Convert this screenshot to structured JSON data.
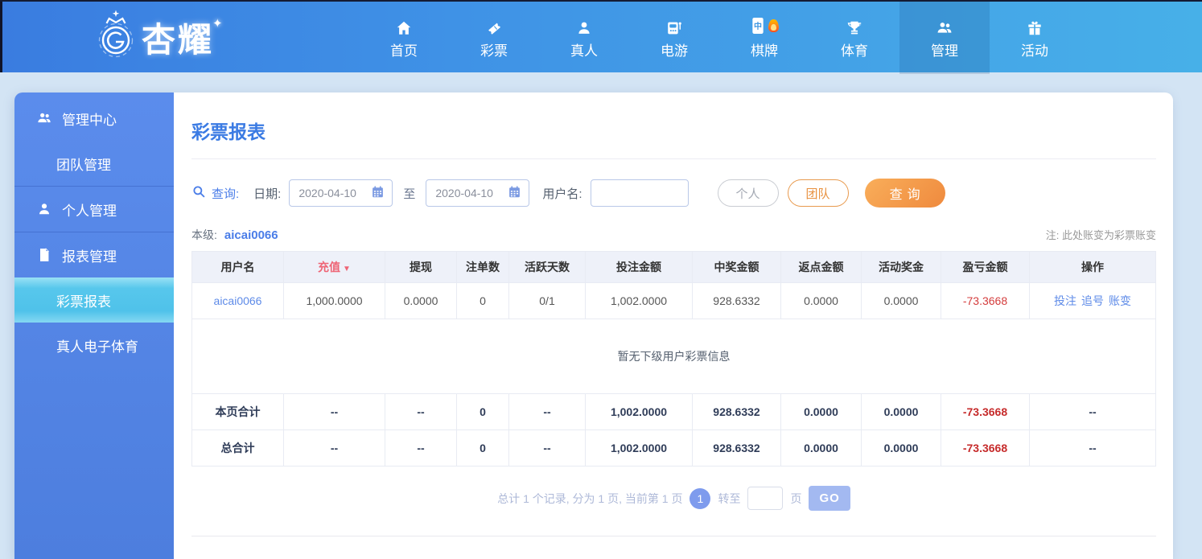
{
  "brand": {
    "name": "杏耀",
    "sparkle": "✦"
  },
  "nav": {
    "items": [
      {
        "label": "首页",
        "icon": "home-icon"
      },
      {
        "label": "彩票",
        "icon": "ticket-icon"
      },
      {
        "label": "真人",
        "icon": "person-icon"
      },
      {
        "label": "电游",
        "icon": "slot-machine-icon"
      },
      {
        "label": "棋牌",
        "icon": "mahjong-icon",
        "hot": true
      },
      {
        "label": "体育",
        "icon": "trophy-icon"
      },
      {
        "label": "管理",
        "icon": "team-icon",
        "active": true
      },
      {
        "label": "活动",
        "icon": "gift-icon"
      }
    ]
  },
  "sidebar": {
    "items": [
      {
        "label": "管理中心",
        "icon": "users-icon",
        "type": "section"
      },
      {
        "label": "团队管理",
        "type": "sub"
      },
      {
        "label": "个人管理",
        "icon": "user-icon",
        "type": "section"
      },
      {
        "label": "报表管理",
        "icon": "report-icon",
        "type": "section"
      },
      {
        "label": "彩票报表",
        "type": "sub",
        "active": true
      },
      {
        "label": "真人电子体育",
        "type": "sub"
      }
    ]
  },
  "page": {
    "title": "彩票报表",
    "level_label": "本级:",
    "level_user": "aicai0066",
    "note": "注: 此处账变为彩票账变"
  },
  "search": {
    "query_label": "查询:",
    "date_label": "日期:",
    "date_from": "2020-04-10",
    "to_label": "至",
    "date_to": "2020-04-10",
    "username_label": "用户名:",
    "username_value": "",
    "personal_button": "个人",
    "team_button": "团队",
    "submit_button": "查询"
  },
  "table": {
    "headers": [
      "用户名",
      "充值",
      "提现",
      "注单数",
      "活跃天数",
      "投注金额",
      "中奖金额",
      "返点金额",
      "活动奖金",
      "盈亏金额",
      "操作"
    ],
    "sort_indicator": "▼",
    "rows": [
      {
        "cells": [
          "aicai0066",
          "1,000.0000",
          "0.0000",
          "0",
          "0/1",
          "1,002.0000",
          "928.6332",
          "0.0000",
          "0.0000",
          "-73.3668"
        ],
        "actions": [
          "投注",
          "追号",
          "账变"
        ]
      }
    ],
    "empty_message": "暂无下级用户彩票信息",
    "page_total": {
      "label": "本页合计",
      "cells": [
        "--",
        "--",
        "0",
        "--",
        "1,002.0000",
        "928.6332",
        "0.0000",
        "0.0000",
        "-73.3668",
        "--"
      ]
    },
    "grand_total": {
      "label": "总合计",
      "cells": [
        "--",
        "--",
        "0",
        "--",
        "1,002.0000",
        "928.6332",
        "0.0000",
        "0.0000",
        "-73.3668",
        "--"
      ]
    }
  },
  "pagination": {
    "summary": "总计 1 个记录, 分为 1 页, 当前第 1 页",
    "current_page": "1",
    "goto_label": "转至",
    "page_unit": "页",
    "goto_value": "",
    "go_button": "GO"
  },
  "colors": {
    "accent_blue": "#3b7be3",
    "nav_blue": "#42a0e6",
    "sidebar_blue": "#5585e6",
    "active_cyan": "#52c4ec",
    "button_orange": "#ef8a3e",
    "sort_pink": "#ee6475",
    "negative_red": "#d43c3c",
    "link_blue": "#5e8be8"
  }
}
